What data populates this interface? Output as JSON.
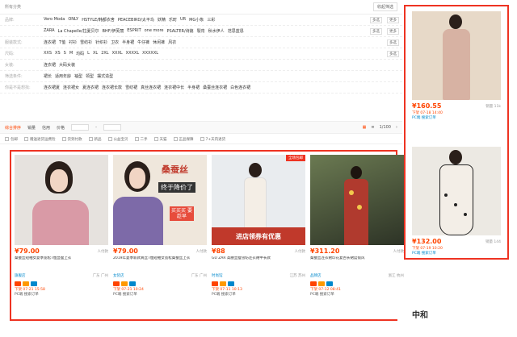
{
  "filter": {
    "all_label": "所有分类",
    "collapse_label": "收起筛选",
    "rows": [
      {
        "label": "品牌:",
        "values": [
          "Vero Moda",
          "ONLY",
          "HSTYLE/韩都衣舍",
          "PEACEBIRD/太平鸟",
          "妖精",
          "乐町",
          "UR",
          "MG小象",
          "三彩"
        ],
        "ops": [
          "多选",
          "更多"
        ]
      },
      {
        "label": "",
        "values": [
          "ZARA",
          "La Chapelle/拉夏贝尔",
          "BHF/伊芙丽",
          "ESPRIT",
          "one more",
          "PSALTER/诗篇",
          "裂帛",
          "秋水伊人",
          "范思蓝恩"
        ],
        "ops": [
          "多选",
          "更多"
        ]
      },
      {
        "label": "服装款式:",
        "values": [
          "连衣裙",
          "T恤",
          "衬衫",
          "雪纺衫",
          "针织衫",
          "卫衣",
          "半身裙",
          "牛仔裤",
          "休闲裤",
          "风衣"
        ],
        "ops": [
          "多选"
        ]
      },
      {
        "label": "尺码:",
        "values": [
          "XXS",
          "XS",
          "S",
          "M",
          "均码",
          "L",
          "XL",
          "2XL",
          "XXXL",
          "XXXXL",
          "XXXXXL"
        ],
        "ops": [
          "多选"
        ]
      },
      {
        "label": "女装:",
        "values": [
          "连衣裙",
          "大码女装"
        ],
        "ops": []
      },
      {
        "label": "筛选条件:",
        "values": [
          "裙长",
          "适用年龄",
          "袖型",
          "领型",
          "摆式造型"
        ],
        "ops": []
      },
      {
        "label": "你是不是想找:",
        "values": [
          "连衣裙夏",
          "连衣裙女",
          "夏连衣裙",
          "连衣裙长款",
          "雪纺裙",
          "真丝连衣裙",
          "连衣裙中长",
          "半身裙",
          "桑蚕丝连衣裙",
          "白色连衣裙"
        ],
        "ops": []
      }
    ]
  },
  "sort": {
    "items": [
      "综合排序",
      "销量",
      "信用",
      "价格"
    ],
    "price_sep": "-",
    "pager": "1/100"
  },
  "options": [
    "包邮",
    "赠送退货运费险",
    "货到付款",
    "新品",
    "公益宝贝",
    "二手",
    "天猫",
    "正品保障",
    "7+天内退货"
  ],
  "products": [
    {
      "price": "¥79.00",
      "side": "人付款",
      "title": "桑蚕丝短袖女夏季宽松T恤显瘦上衣",
      "shop": "旗舰店",
      "loc": "广东 广州",
      "meta1": "下架 07-21 15:58",
      "meta2": "PC端 搜索订单"
    },
    {
      "price": "¥79.00",
      "side": "人付款",
      "title": "2019年夏季新款真丝T恤短袖女宽松桑蚕丝上衣",
      "shop": "女装店",
      "loc": "广东 广州",
      "meta1": "下架 07-21 10:24",
      "meta2": "PC端 搜索订单",
      "overlay1": "桑蚕丝",
      "overlay2": "终于降价了",
      "overlay3": "买买买 要趁早"
    },
    {
      "price": "¥88",
      "side": "人付款",
      "title": "GU ZAR 高腰显瘦雪纺连衣裙中长款",
      "shop": "时尚馆",
      "loc": "江苏 苏州",
      "meta1": "下架 07-11 10:13",
      "meta2": "PC端 搜索订单",
      "badge": "进店领券有优惠",
      "corner": "全场包邮"
    },
    {
      "price": "¥311.20",
      "side": "人付款",
      "title": "桑蚕丝连衣裙印花复古长裙度假风",
      "shop": "品牌店",
      "loc": "浙江 杭州",
      "meta1": "下架 07-12 08:41",
      "meta2": "PC端 搜索订单"
    }
  ],
  "right": [
    {
      "price": "¥160.55",
      "side": "销量 11k",
      "meta1": "下架 07-18 14:40",
      "meta2": "PC端 搜索订单"
    },
    {
      "price": "¥132.00",
      "side": "销量 144",
      "meta1": "下架 07-19 10:20",
      "meta2": "PC端 搜索订单"
    }
  ],
  "right_bottom_label": "中和",
  "colors": {
    "accent": "#ff4400",
    "frame": "#ee3322",
    "link": "#0088cc"
  }
}
